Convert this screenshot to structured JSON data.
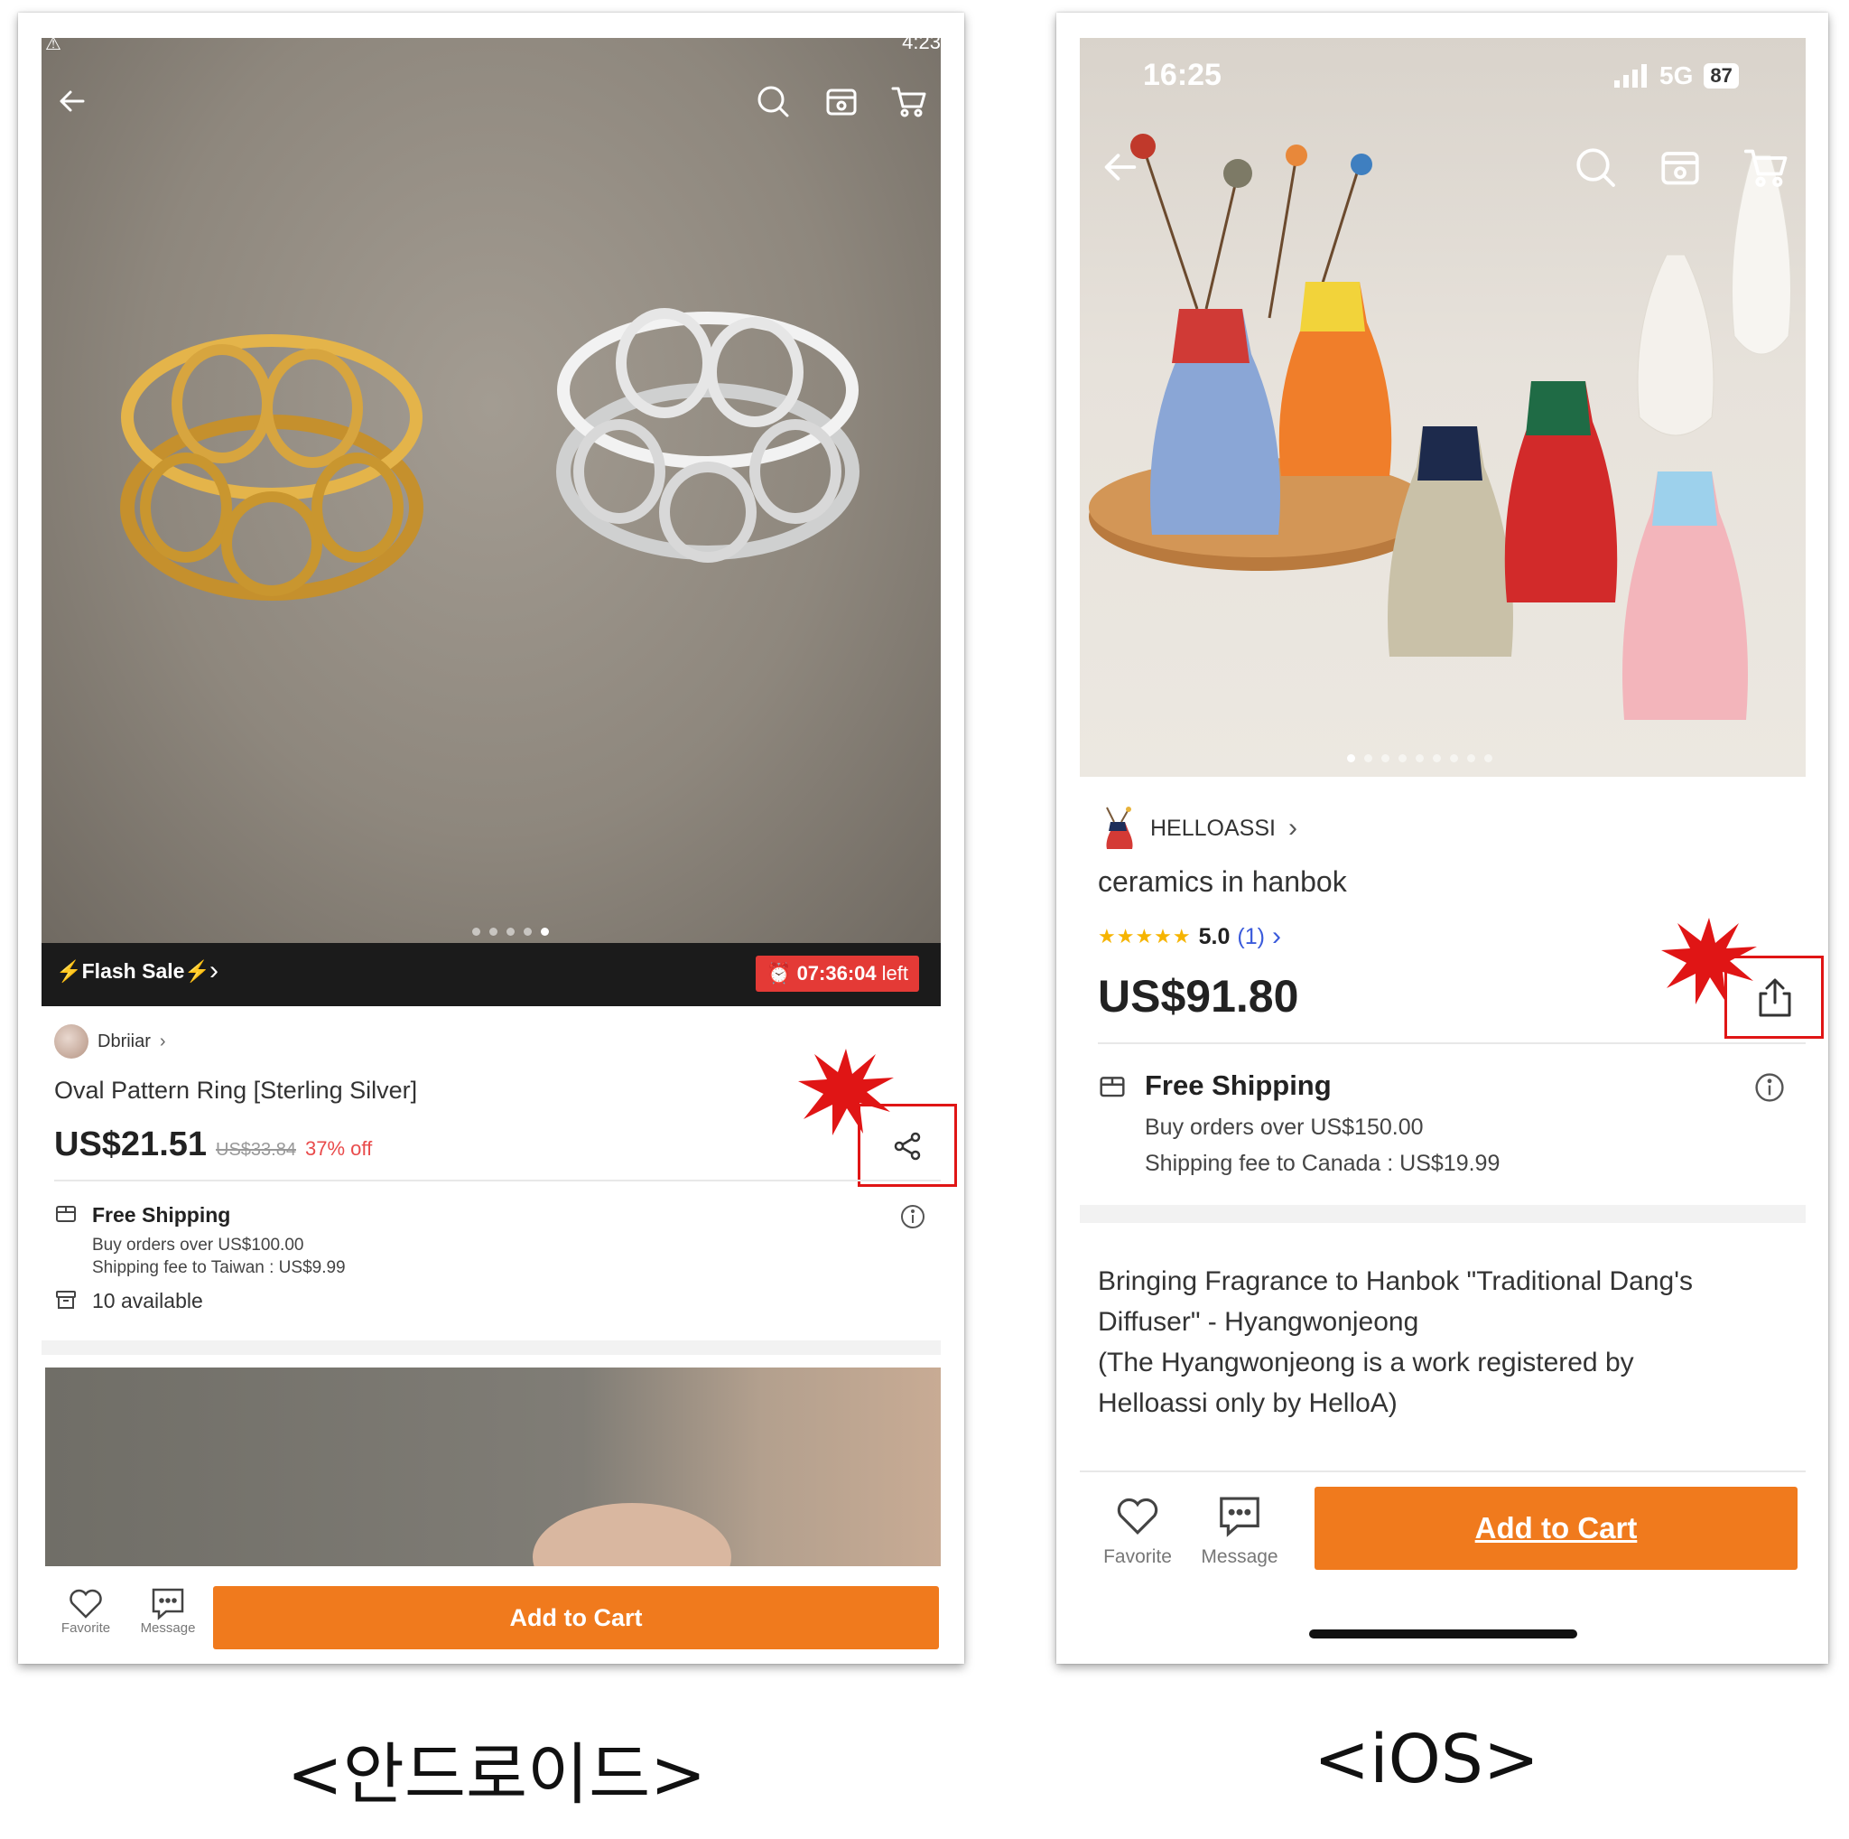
{
  "android": {
    "status_time": "4:23",
    "flash_sale": {
      "label": "⚡Flash Sale⚡",
      "timer": "07:36:04",
      "timer_suffix": "left"
    },
    "image_dots": {
      "count": 5,
      "active_index": 4
    },
    "seller": {
      "name": "Dbriiar"
    },
    "product": {
      "title": "Oval Pattern Ring [Sterling Silver]",
      "price": "US$21.51",
      "original_price": "US$33.84",
      "discount": "37% off"
    },
    "shipping": {
      "title": "Free Shipping",
      "line1": "Buy orders over US$100.00",
      "line2": "Shipping fee to Taiwan : US$9.99"
    },
    "stock": "10 available",
    "bottom_bar": {
      "favorite_label": "Favorite",
      "message_label": "Message",
      "add_to_cart": "Add to Cart"
    },
    "caption": "<안드로이드>"
  },
  "ios": {
    "status": {
      "time": "16:25",
      "network": "5G",
      "battery": "87"
    },
    "image_dots": {
      "count": 9,
      "active_index": 0
    },
    "seller": {
      "name": "HELLOASSI"
    },
    "product": {
      "title": "ceramics in hanbok",
      "rating": "5.0",
      "review_count": "(1)",
      "price": "US$91.80"
    },
    "shipping": {
      "title": "Free Shipping",
      "line1": "Buy orders over US$150.00",
      "line2": "Shipping fee to Canada : US$19.99"
    },
    "description": [
      "Bringing Fragrance to Hanbok \"Traditional Dang's",
      "Diffuser\" - Hyangwonjeong",
      "(The Hyangwonjeong is a work registered by",
      "Helloassi only by HelloA)"
    ],
    "bottom_bar": {
      "favorite_label": "Favorite",
      "message_label": "Message",
      "add_to_cart": "Add to Cart"
    },
    "caption": "<iOS>"
  },
  "colors": {
    "accent_orange": "#f07a1d",
    "highlight_red": "#e01515",
    "sale_red": "#e94b4b",
    "star_gold": "#f6b400",
    "link_blue": "#3b5bdb"
  },
  "icons": [
    "back-arrow-icon",
    "search-icon",
    "store-icon",
    "cart-icon",
    "share-icon",
    "heart-icon",
    "message-icon",
    "shipping-box-icon",
    "info-icon",
    "stock-box-icon",
    "alarm-clock-icon",
    "chevron-right-icon",
    "starburst-icon"
  ]
}
